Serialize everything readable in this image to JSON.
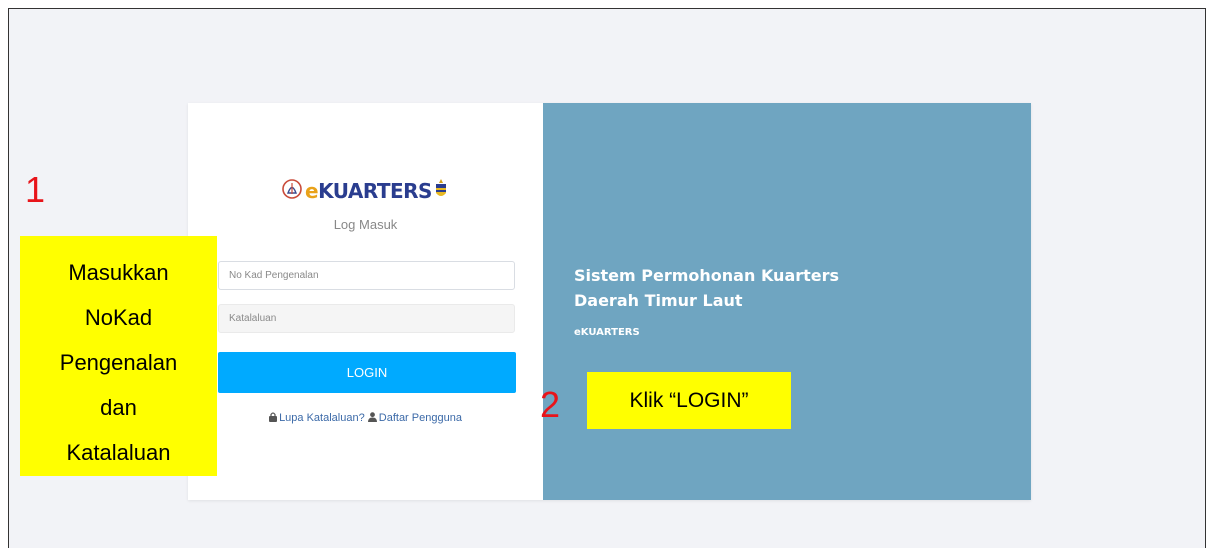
{
  "brand": {
    "logo_e": "e",
    "logo_rest": "KUARTERS",
    "subtitle": "Log Masuk"
  },
  "form": {
    "ic_placeholder": "No Kad Pengenalan",
    "password_placeholder": "Katalaluan",
    "login_label": "LOGIN"
  },
  "links": {
    "forgot_label": "Lupa Katalaluan?",
    "register_label": "Daftar Pengguna"
  },
  "right_panel": {
    "title_line1": "Sistem Permohonan Kuarters",
    "title_line2": "Daerah Timur Laut",
    "small": "eKUARTERS"
  },
  "annotations": {
    "step1_number": "1",
    "step1_lines": [
      "Masukkan",
      "NoKad",
      "Pengenalan",
      "dan",
      "Katalaluan"
    ],
    "step2_number": "2",
    "step2_text": "Klik “LOGIN”"
  },
  "colors": {
    "login_button": "#00aaff",
    "right_panel": "#6fa5c1",
    "annotation_highlight": "#ffff00",
    "step_number": "#e8141a",
    "logo_e": "#e9a21a",
    "logo_text": "#2a3d8f"
  }
}
